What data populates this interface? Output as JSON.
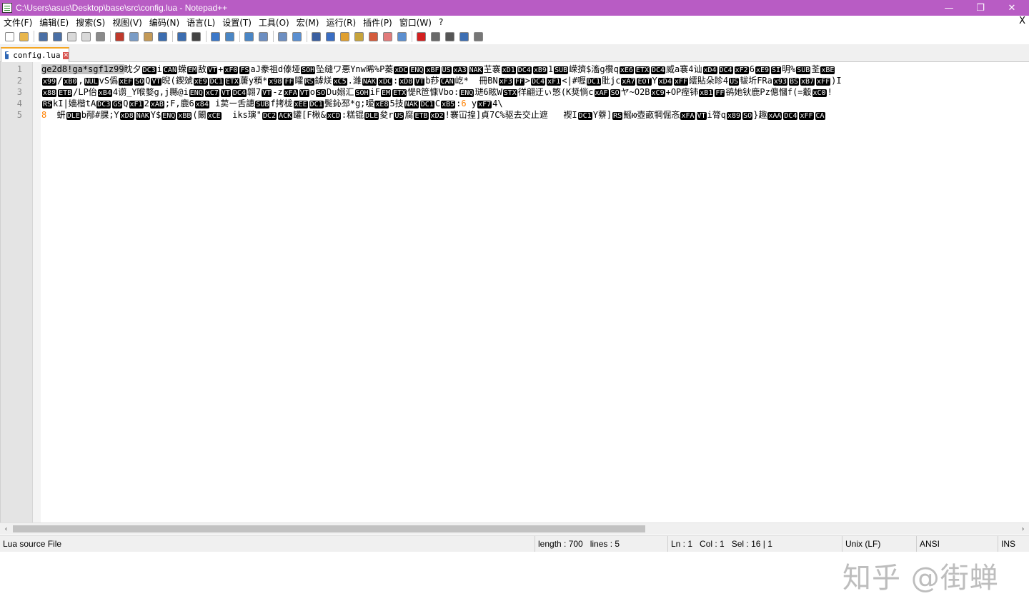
{
  "window": {
    "title": "C:\\Users\\asus\\Desktop\\base\\src\\config.lua - Notepad++",
    "controls": [
      "—",
      "❐",
      "✕"
    ]
  },
  "menu": {
    "items": [
      "文件(F)",
      "编辑(E)",
      "搜索(S)",
      "视图(V)",
      "编码(N)",
      "语言(L)",
      "设置(T)",
      "工具(O)",
      "宏(M)",
      "运行(R)",
      "插件(P)",
      "窗口(W)",
      "?"
    ],
    "close": "X"
  },
  "toolbar": {
    "buttons": [
      {
        "name": "new-file-icon",
        "color": "#ffffff"
      },
      {
        "name": "open-file-icon",
        "color": "#e8b64c"
      },
      {
        "name": "save-icon",
        "color": "#4a6fa5"
      },
      {
        "name": "save-all-icon",
        "color": "#4a6fa5"
      },
      {
        "name": "close-icon",
        "color": "#d9d9d9"
      },
      {
        "name": "close-all-icon",
        "color": "#d9d9d9"
      },
      {
        "name": "print-icon",
        "color": "#8a8a8a"
      },
      {
        "name": "cut-icon",
        "color": "#c0392b"
      },
      {
        "name": "copy-icon",
        "color": "#7a9cc6"
      },
      {
        "name": "paste-icon",
        "color": "#c49a57"
      },
      {
        "name": "undo-icon",
        "color": "#3c6db0"
      },
      {
        "name": "redo-icon",
        "color": "#3c6db0"
      },
      {
        "name": "find-icon",
        "color": "#444444"
      },
      {
        "name": "replace-icon",
        "color": "#3a77c9"
      },
      {
        "name": "zoom-in-icon",
        "color": "#4a86c5"
      },
      {
        "name": "zoom-out-icon",
        "color": "#4a86c5"
      },
      {
        "name": "sync-vertical-icon",
        "color": "#6d8fc2"
      },
      {
        "name": "sync-horizontal-icon",
        "color": "#6d8fc2"
      },
      {
        "name": "word-wrap-icon",
        "color": "#5a8fd1"
      },
      {
        "name": "show-all-chars-icon",
        "color": "#3a5fa0"
      },
      {
        "name": "indent-guide-icon",
        "color": "#3a6ec4"
      },
      {
        "name": "doc-map-icon",
        "color": "#e0a030"
      },
      {
        "name": "function-list-icon",
        "color": "#c7a43c"
      },
      {
        "name": "folder-as-workspace-icon",
        "color": "#d45b3c"
      },
      {
        "name": "monitoring-icon",
        "color": "#e27b7b"
      },
      {
        "name": "eye-icon",
        "color": "#5c8fcf"
      },
      {
        "name": "record-macro-icon",
        "color": "#d42020"
      },
      {
        "name": "stop-record-icon",
        "color": "#6a6a6a"
      },
      {
        "name": "playback-macro-icon",
        "color": "#555555"
      },
      {
        "name": "run-macro-multiple-icon",
        "color": "#3e6fb3"
      },
      {
        "name": "save-macro-icon",
        "color": "#777777"
      }
    ]
  },
  "tab": {
    "label": "config.lua",
    "close": "✕"
  },
  "editor": {
    "line_numbers": [
      "1",
      "2",
      "3",
      "4",
      "5"
    ],
    "lines": [
      [
        {
          "t": "sel",
          "v": "ge2d8!ga*sgf1z99"
        },
        {
          "t": "txt",
          "v": "眈夕"
        },
        {
          "t": "ctl",
          "v": "DC3"
        },
        {
          "t": "txt",
          "v": "i"
        },
        {
          "t": "ctl",
          "v": "CAN"
        },
        {
          "t": "txt",
          "v": "蝾"
        },
        {
          "t": "ctl",
          "v": "EM"
        },
        {
          "t": "txt",
          "v": "敌"
        },
        {
          "t": "ctl",
          "v": "VT"
        },
        {
          "t": "txt",
          "v": "+"
        },
        {
          "t": "ctl",
          "v": "xF0"
        },
        {
          "t": "ctl",
          "v": "FS"
        },
        {
          "t": "txt",
          "v": "aJ豢祖d傣垭"
        },
        {
          "t": "ctl",
          "v": "SOH"
        },
        {
          "t": "txt",
          "v": "坠缝ワ悪Ynw晞%P蓁"
        },
        {
          "t": "ctl",
          "v": "xDC"
        },
        {
          "t": "ctl",
          "v": "ENQ"
        },
        {
          "t": "ctl",
          "v": "xBF"
        },
        {
          "t": "ctl",
          "v": "US"
        },
        {
          "t": "ctl",
          "v": "xA3"
        },
        {
          "t": "ctl",
          "v": "NAK"
        },
        {
          "t": "txt",
          "v": "芏褰"
        },
        {
          "t": "ctl",
          "v": "xD1"
        },
        {
          "t": "ctl",
          "v": "DC4"
        },
        {
          "t": "ctl",
          "v": "xB9"
        },
        {
          "t": "txt",
          "v": "1"
        },
        {
          "t": "ctl",
          "v": "SUB"
        },
        {
          "t": "txt",
          "v": "嵘擠$滀g欑q"
        },
        {
          "t": "ctl",
          "v": "xE6"
        },
        {
          "t": "ctl",
          "v": "ETX"
        },
        {
          "t": "ctl",
          "v": "DC4"
        },
        {
          "t": "txt",
          "v": "威a褰4讪"
        },
        {
          "t": "ctl",
          "v": "xD4"
        },
        {
          "t": "ctl",
          "v": "DC4"
        },
        {
          "t": "ctl",
          "v": "xF2"
        },
        {
          "t": "txt",
          "v": "6"
        },
        {
          "t": "ctl",
          "v": "xE9"
        },
        {
          "t": "ctl",
          "v": "SI"
        },
        {
          "t": "txt",
          "v": "明%"
        },
        {
          "t": "ctl",
          "v": "SUB"
        },
        {
          "t": "txt",
          "v": "荃"
        },
        {
          "t": "ctl",
          "v": "xBE"
        }
      ],
      [
        {
          "t": "ctl",
          "v": "x99"
        },
        {
          "t": "txt",
          "v": "/"
        },
        {
          "t": "ctl",
          "v": "xB0"
        },
        {
          "t": "txt",
          "v": ","
        },
        {
          "t": "ctl",
          "v": "NUL"
        },
        {
          "t": "txt",
          "v": "vS僞"
        },
        {
          "t": "ctl",
          "v": "xEF"
        },
        {
          "t": "ctl",
          "v": "SO"
        },
        {
          "t": "txt",
          "v": "Q"
        },
        {
          "t": "ctl",
          "v": "VT"
        },
        {
          "t": "txt",
          "v": "晲(鍥虠"
        },
        {
          "t": "ctl",
          "v": "xE9"
        },
        {
          "t": "ctl",
          "v": "DC1"
        },
        {
          "t": "ctl",
          "v": "ETX"
        },
        {
          "t": "txt",
          "v": "蓎y頪*"
        },
        {
          "t": "ctl",
          "v": "x98"
        },
        {
          "t": "ctl",
          "v": "FF"
        },
        {
          "t": "txt",
          "v": "矐"
        },
        {
          "t": "ctl",
          "v": "RS"
        },
        {
          "t": "txt",
          "v": "鏬烪"
        },
        {
          "t": "ctl",
          "v": "xC5"
        },
        {
          "t": "txt",
          "v": ".濰"
        },
        {
          "t": "ctl",
          "v": "NAK"
        },
        {
          "t": "ctl",
          "v": "xDC"
        },
        {
          "t": "txt",
          "v": ":"
        },
        {
          "t": "ctl",
          "v": "xD8"
        },
        {
          "t": "ctl",
          "v": "VT"
        },
        {
          "t": "txt",
          "v": "b莏"
        },
        {
          "t": "ctl",
          "v": "CAN"
        },
        {
          "t": "txt",
          "v": "屹*  冊BN"
        },
        {
          "t": "ctl",
          "v": "xF3"
        },
        {
          "t": "ctl",
          "v": "FF"
        },
        {
          "t": "txt",
          "v": ">"
        },
        {
          "t": "ctl",
          "v": "DC4"
        },
        {
          "t": "ctl",
          "v": "xF1"
        },
        {
          "t": "txt",
          "v": "<|#嚦"
        },
        {
          "t": "ctl",
          "v": "DC1"
        },
        {
          "t": "txt",
          "v": "肶jc"
        },
        {
          "t": "ctl",
          "v": "xA7"
        },
        {
          "t": "ctl",
          "v": "EOT"
        },
        {
          "t": "txt",
          "v": "Y"
        },
        {
          "t": "ctl",
          "v": "xD4"
        },
        {
          "t": "ctl",
          "v": "xFF"
        },
        {
          "t": "txt",
          "v": "繧貼朵眕4"
        },
        {
          "t": "ctl",
          "v": "US"
        },
        {
          "t": "txt",
          "v": "韨圻FRa"
        },
        {
          "t": "ctl",
          "v": "x93"
        },
        {
          "t": "ctl",
          "v": "BS"
        },
        {
          "t": "ctl",
          "v": "xB7"
        },
        {
          "t": "ctl",
          "v": "xFF"
        },
        {
          "t": "txt",
          "v": ")I"
        }
      ],
      [
        {
          "t": "ctl",
          "v": "x88"
        },
        {
          "t": "ctl",
          "v": "ETB"
        },
        {
          "t": "txt",
          "v": "/LP佁"
        },
        {
          "t": "ctl",
          "v": "xB4"
        },
        {
          "t": "txt",
          "v": "4谫_Y喉婺g,j縣@i"
        },
        {
          "t": "ctl",
          "v": "ENQ"
        },
        {
          "t": "ctl",
          "v": "xC7"
        },
        {
          "t": "ctl",
          "v": "VT"
        },
        {
          "t": "ctl",
          "v": "DC4"
        },
        {
          "t": "txt",
          "v": "翶7"
        },
        {
          "t": "ctl",
          "v": "VT"
        },
        {
          "t": "txt",
          "v": "-z"
        },
        {
          "t": "ctl",
          "v": "xFA"
        },
        {
          "t": "ctl",
          "v": "VT"
        },
        {
          "t": "txt",
          "v": "o"
        },
        {
          "t": "ctl",
          "v": "SO"
        },
        {
          "t": "txt",
          "v": "Du嫋汇"
        },
        {
          "t": "ctl",
          "v": "SOH"
        },
        {
          "t": "txt",
          "v": "iF"
        },
        {
          "t": "ctl",
          "v": "EM"
        },
        {
          "t": "ctl",
          "v": "ETX"
        },
        {
          "t": "txt",
          "v": "惿R笸慷Vbo:"
        },
        {
          "t": "ctl",
          "v": "ENQ"
        },
        {
          "t": "txt",
          "v": "琎6眩W"
        },
        {
          "t": "ctl",
          "v": "STX"
        },
        {
          "t": "txt",
          "v": "徉翩迂ぃ慜(K奨惝c"
        },
        {
          "t": "ctl",
          "v": "xAF"
        },
        {
          "t": "ctl",
          "v": "SO"
        },
        {
          "t": "txt",
          "v": "ヤ~O2B"
        },
        {
          "t": "ctl",
          "v": "xC9"
        },
        {
          "t": "txt",
          "v": "+OP痓铈"
        },
        {
          "t": "ctl",
          "v": "xB1"
        },
        {
          "t": "ctl",
          "v": "FF"
        },
        {
          "t": "txt",
          "v": "鹆她钬鹿Pz傯慖f(=觳"
        },
        {
          "t": "ctl",
          "v": "xC0"
        },
        {
          "t": "txt",
          "v": "!"
        }
      ],
      [
        {
          "t": "ctl",
          "v": "RS"
        },
        {
          "t": "txt",
          "v": "kI|嫱楷tA"
        },
        {
          "t": "ctl",
          "v": "DC3"
        },
        {
          "t": "ctl",
          "v": "GS"
        },
        {
          "t": "txt",
          "v": "Q"
        },
        {
          "t": "ctl",
          "v": "xF1"
        },
        {
          "t": "txt",
          "v": "2"
        },
        {
          "t": "ctl",
          "v": "xAB"
        },
        {
          "t": "txt",
          "v": ";F,鹿6"
        },
        {
          "t": "ctl",
          "v": "x84"
        },
        {
          "t": "txt",
          "v": " i荬ー舌譓"
        },
        {
          "t": "ctl",
          "v": "SUB"
        },
        {
          "t": "txt",
          "v": "f拷栊"
        },
        {
          "t": "ctl",
          "v": "xEE"
        },
        {
          "t": "ctl",
          "v": "DC1"
        },
        {
          "t": "txt",
          "v": "鬓鈊邳*g;嗳"
        },
        {
          "t": "ctl",
          "v": "xE8"
        },
        {
          "t": "txt",
          "v": "5技"
        },
        {
          "t": "ctl",
          "v": "NAK"
        },
        {
          "t": "ctl",
          "v": "DC1"
        },
        {
          "t": "txt",
          "v": "C"
        },
        {
          "t": "ctl",
          "v": "xB5"
        },
        {
          "t": "txt",
          "v": ":"
        },
        {
          "t": "num",
          "v": "6"
        },
        {
          "t": "txt",
          "v": " y"
        },
        {
          "t": "ctl",
          "v": "xF7"
        },
        {
          "t": "txt",
          "v": "4\\"
        }
      ],
      [
        {
          "t": "num",
          "v": "8"
        },
        {
          "t": "txt",
          "v": "  蚈"
        },
        {
          "t": "ctl",
          "v": "DLE"
        },
        {
          "t": "txt",
          "v": "b邴#腂;Y"
        },
        {
          "t": "ctl",
          "v": "xD8"
        },
        {
          "t": "ctl",
          "v": "NAK"
        },
        {
          "t": "txt",
          "v": "Y$"
        },
        {
          "t": "ctl",
          "v": "ENQ"
        },
        {
          "t": "ctl",
          "v": "xBB"
        },
        {
          "t": "txt",
          "v": "(闞"
        },
        {
          "t": "ctl",
          "v": "xCE"
        },
        {
          "t": "txt",
          "v": "  iks璌\""
        },
        {
          "t": "ctl",
          "v": "DC2"
        },
        {
          "t": "ctl",
          "v": "ACK"
        },
        {
          "t": "txt",
          "v": "罐[F楸&"
        },
        {
          "t": "ctl",
          "v": "xCD"
        },
        {
          "t": "txt",
          "v": ":糕锟"
        },
        {
          "t": "ctl",
          "v": "DLE"
        },
        {
          "t": "txt",
          "v": "夋r"
        },
        {
          "t": "ctl",
          "v": "US"
        },
        {
          "t": "txt",
          "v": "腐"
        },
        {
          "t": "ctl",
          "v": "ETB"
        },
        {
          "t": "ctl",
          "v": "xD2"
        },
        {
          "t": "txt",
          "v": "!褰冚揘]貞7C%驱去交止遮   褉I"
        },
        {
          "t": "ctl",
          "v": "DC1"
        },
        {
          "t": "txt",
          "v": "Y藔]"
        },
        {
          "t": "ctl",
          "v": "RS"
        },
        {
          "t": "txt",
          "v": "鰩ю壺畞犅倔忞"
        },
        {
          "t": "ctl",
          "v": "xFA"
        },
        {
          "t": "ctl",
          "v": "VT"
        },
        {
          "t": "txt",
          "v": "i膂q"
        },
        {
          "t": "ctl",
          "v": "x89"
        },
        {
          "t": "ctl",
          "v": "SO"
        },
        {
          "t": "txt",
          "v": "}趣"
        },
        {
          "t": "ctl",
          "v": "xAA"
        },
        {
          "t": "ctl",
          "v": "DC4"
        },
        {
          "t": "ctl",
          "v": "xFF"
        },
        {
          "t": "ctl",
          "v": "CA"
        }
      ]
    ]
  },
  "watermark": "知乎 @街蝉",
  "hscroll": {
    "left": "‹",
    "right": "›",
    "thumb_fraction": 0.63
  },
  "status": {
    "file_type": "Lua source File",
    "length": "length : 700",
    "lines": "lines : 5",
    "ln": "Ln : 1",
    "col": "Col : 1",
    "sel": "Sel : 16 | 1",
    "eol": "Unix (LF)",
    "encoding": "ANSI",
    "mode": "INS"
  }
}
